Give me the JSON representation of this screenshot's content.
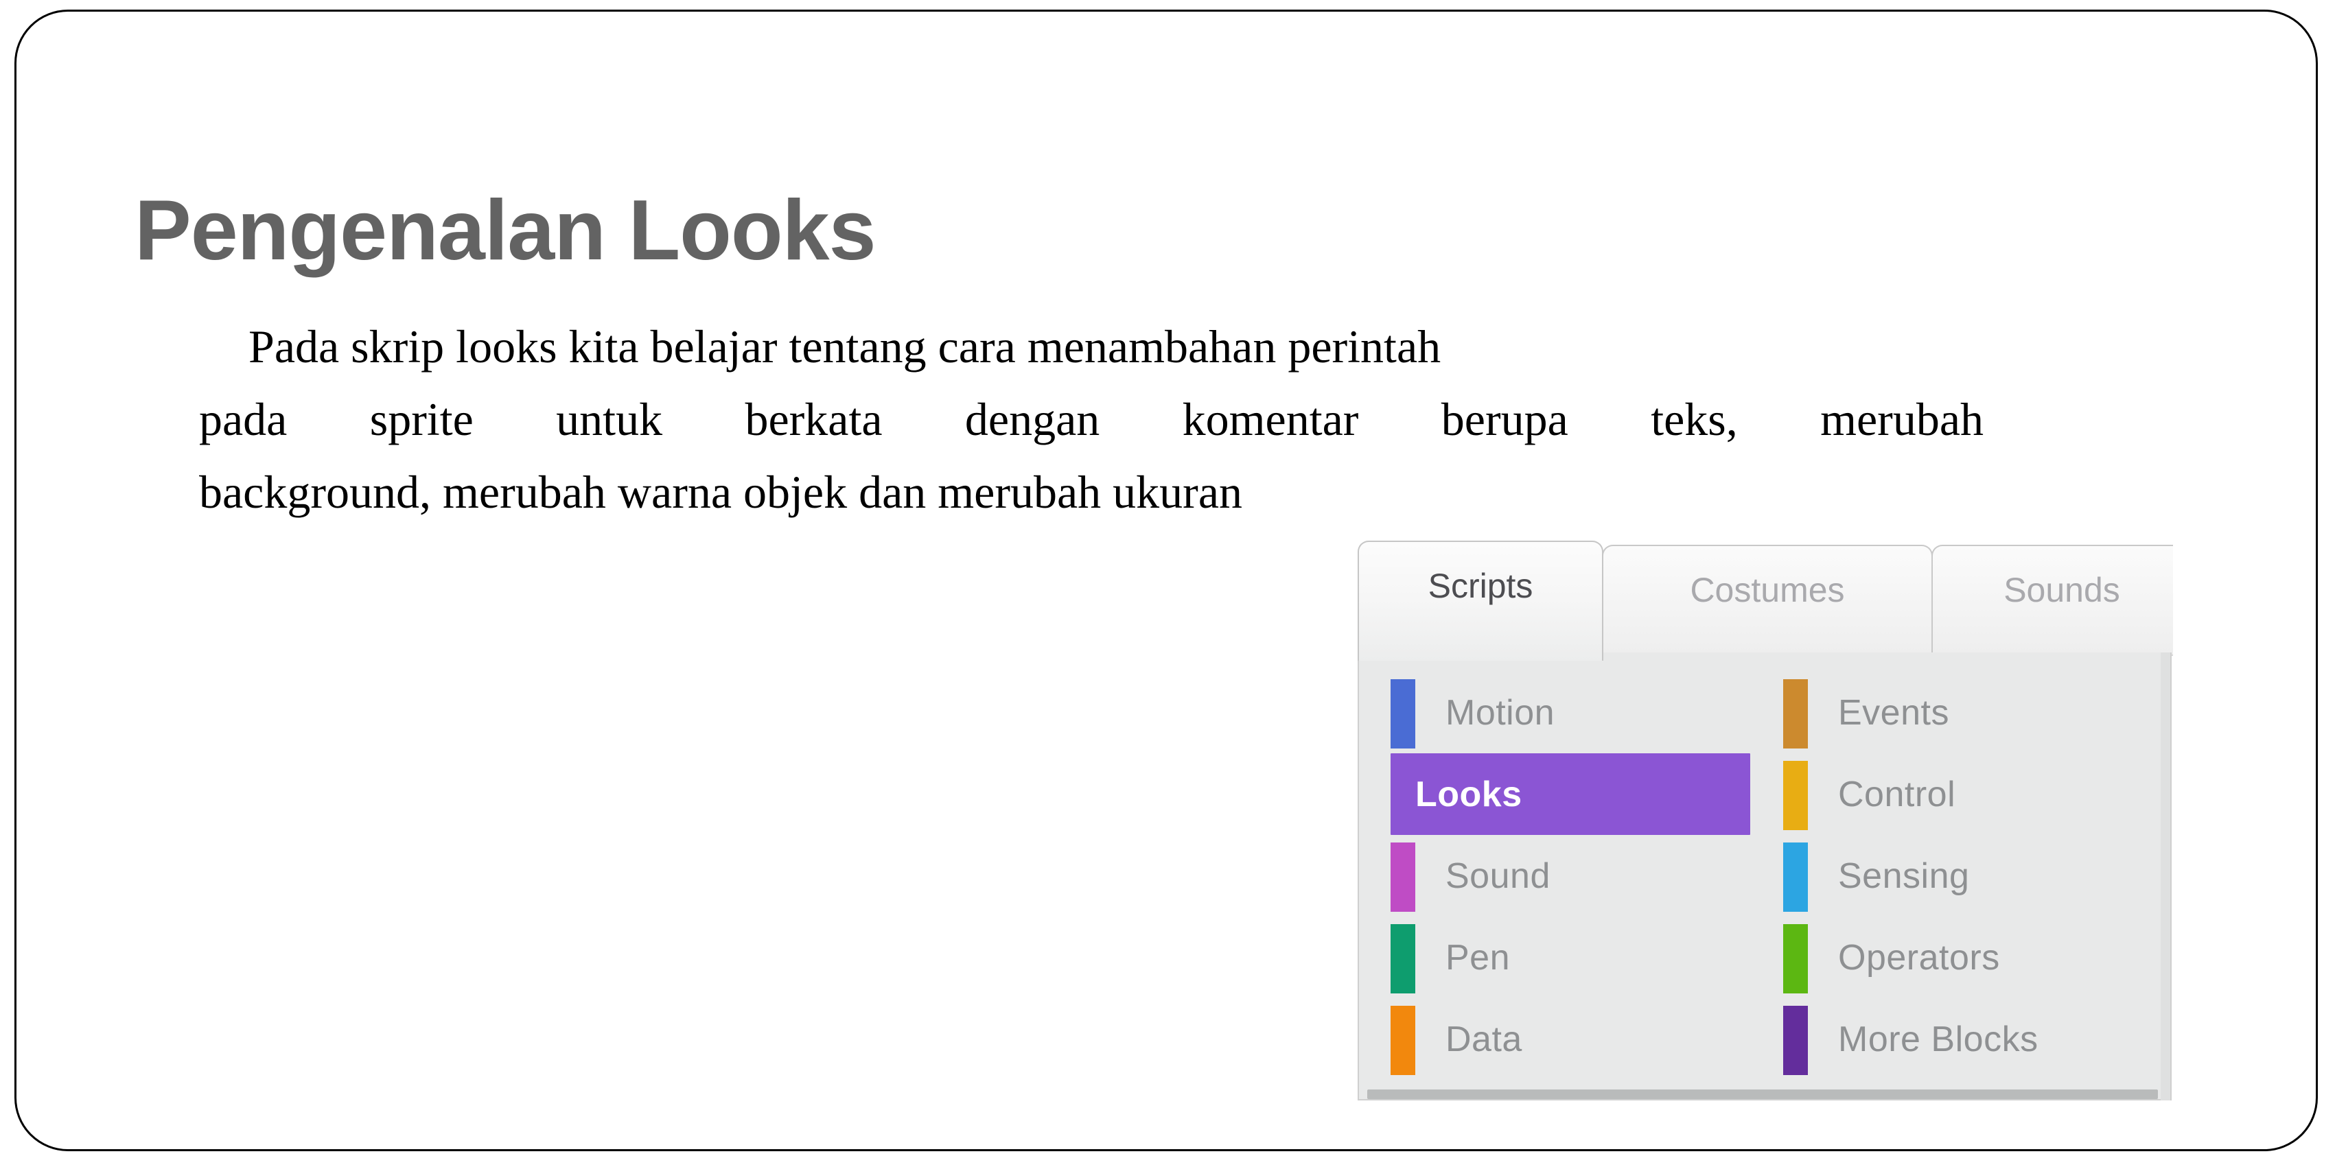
{
  "slide": {
    "title": "Pengenalan Looks",
    "title_color": "#636363",
    "border_color": "#000000",
    "background_color": "#ffffff",
    "body_paragraph": "Pada skrip looks kita belajar tentang cara menambahan perintah pada sprite untuk berkata dengan komentar berupa teks, merubah background, merubah warna objek dan merubah ukuran",
    "body_lines": [
      "Pada skrip looks kita belajar tentang cara menambahan perintah",
      "pada sprite untuk berkata dengan komentar berupa teks, merubah",
      "background, merubah warna objek dan merubah ukuran"
    ]
  },
  "scratch_panel": {
    "tabs": [
      {
        "label": "Scripts",
        "active": true
      },
      {
        "label": "Costumes",
        "active": false
      },
      {
        "label": "Sounds",
        "active": false
      }
    ],
    "selected_tab": "Scripts",
    "panel_background": "#e8e9e9",
    "selected_highlight_color": "#8B55D4",
    "label_color": "#8e9092",
    "categories_left": [
      {
        "label": "Motion",
        "color": "#4A6CD4",
        "selected": false
      },
      {
        "label": "Looks",
        "color": "#8B55D4",
        "selected": true
      },
      {
        "label": "Sound",
        "color": "#BF4CC5",
        "selected": false
      },
      {
        "label": "Pen",
        "color": "#0E9D6E",
        "selected": false
      },
      {
        "label": "Data",
        "color": "#F2880D",
        "selected": false
      }
    ],
    "categories_right": [
      {
        "label": "Events",
        "color": "#CC8A2E",
        "selected": false
      },
      {
        "label": "Control",
        "color": "#E8AD13",
        "selected": false
      },
      {
        "label": "Sensing",
        "color": "#2CA5E2",
        "selected": false
      },
      {
        "label": "Operators",
        "color": "#5CB712",
        "selected": false
      },
      {
        "label": "More Blocks",
        "color": "#632D9C",
        "selected": false
      }
    ]
  }
}
